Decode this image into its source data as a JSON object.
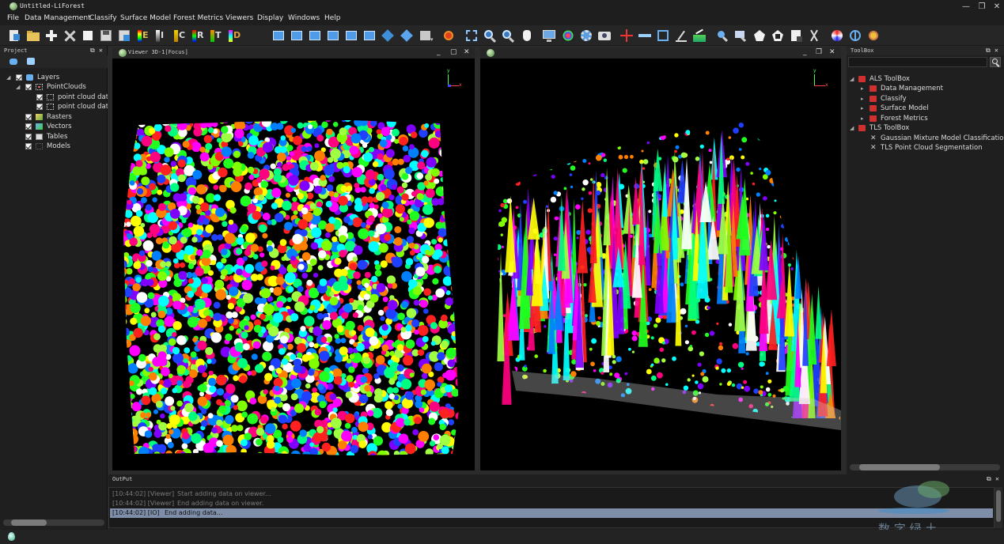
{
  "window": {
    "title": "Untitled-LiForest",
    "controls": {
      "minimize": "—",
      "restore": "❐",
      "close": "✕"
    }
  },
  "menu": [
    "File",
    "Data Management",
    "Classify",
    "Surface Model",
    "Forest Metrics",
    "Viewers",
    "Display",
    "Windows",
    "Help"
  ],
  "toolbar": {
    "letter_buttons": [
      "E",
      "I",
      "C",
      "R",
      "T",
      "D"
    ]
  },
  "project": {
    "title": "Project",
    "tree": [
      {
        "label": "Layers",
        "level": 0
      },
      {
        "label": "PointClouds",
        "level": 1
      },
      {
        "label": "point cloud data",
        "level": 2
      },
      {
        "label": "point cloud data",
        "level": 2
      },
      {
        "label": "Rasters",
        "level": 1
      },
      {
        "label": "Vectors",
        "level": 1
      },
      {
        "label": "Tables",
        "level": 1
      },
      {
        "label": "Models",
        "level": 1
      }
    ]
  },
  "viewers": [
    {
      "title": "Viewer 3D-1[Focus]"
    },
    {
      "title": ""
    }
  ],
  "axis": {
    "y": "y",
    "x": "x"
  },
  "toolbox": {
    "title": "ToolBox",
    "search_placeholder": "",
    "tree": [
      {
        "label": "ALS ToolBox",
        "level": 0
      },
      {
        "label": "Data Management",
        "level": 1
      },
      {
        "label": "Classify",
        "level": 1
      },
      {
        "label": "Surface Model",
        "level": 1
      },
      {
        "label": "Forest Metrics",
        "level": 1
      },
      {
        "label": "TLS ToolBox",
        "level": 0
      },
      {
        "label": "Gaussian Mixture Model Classification",
        "level": 1
      },
      {
        "label": "TLS Point Cloud Segmentation",
        "level": 1
      }
    ]
  },
  "output": {
    "title": "OutPut",
    "lines": [
      {
        "prefix": "[10:44:02] [Viewer]",
        "message": "Start adding data on viewer..."
      },
      {
        "prefix": "[10:44:02] [Viewer]",
        "message": "End adding data on viewer."
      },
      {
        "prefix": "[10:44:02] [IO]",
        "message": "End adding data..."
      }
    ]
  },
  "watermark": "数 字 绿 土",
  "colors": {
    "background": "#2b2b2b",
    "panel": "#1f1f1f",
    "selection": "#7f8ea8"
  }
}
